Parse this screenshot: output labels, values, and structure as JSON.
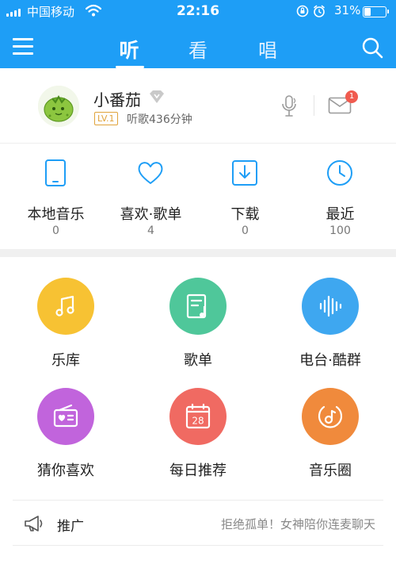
{
  "status_bar": {
    "carrier": "中国移动",
    "time": "22:16",
    "battery_percent": "31%",
    "battery_level": 0.31,
    "icons": [
      "signal-icon",
      "wifi-icon",
      "rotation-lock-icon",
      "alarm-icon",
      "battery-icon"
    ]
  },
  "nav": {
    "tabs": [
      {
        "label": "听",
        "active": true
      },
      {
        "label": "看",
        "active": false
      },
      {
        "label": "唱",
        "active": false
      }
    ],
    "icons": {
      "left": "menu-icon",
      "right": "search-icon"
    },
    "accent_color": "#1e9ef6"
  },
  "user": {
    "name": "小番茄",
    "level": "LV.1",
    "listen_time": "听歌436分钟",
    "message_badge": "1",
    "icons": [
      "avatar",
      "vip-diamond-icon",
      "microphone-icon",
      "mail-icon"
    ]
  },
  "quick_stats": [
    {
      "label": "本地音乐",
      "count": "0",
      "icon": "phone-icon"
    },
    {
      "label": "喜欢·歌单",
      "count": "4",
      "icon": "heart-icon"
    },
    {
      "label": "下载",
      "count": "0",
      "icon": "download-icon"
    },
    {
      "label": "最近",
      "count": "100",
      "icon": "clock-icon"
    }
  ],
  "grid": [
    {
      "label": "乐库",
      "icon": "music-note-icon",
      "color": "#f7c233"
    },
    {
      "label": "歌单",
      "icon": "playlist-icon",
      "color": "#4fc79a"
    },
    {
      "label": "电台·酷群",
      "icon": "sound-wave-icon",
      "color": "#3ea7f0"
    },
    {
      "label": "猜你喜欢",
      "icon": "radio-heart-icon",
      "color": "#c164dc"
    },
    {
      "label": "每日推荐",
      "icon": "calendar-icon",
      "calendar_day": "28",
      "color": "#f06a62"
    },
    {
      "label": "音乐圈",
      "icon": "music-circle-icon",
      "color": "#f08a3c"
    }
  ],
  "promo": {
    "label": "推广",
    "text": "拒绝孤单！女神陪你连麦聊天",
    "icon": "megaphone-icon"
  }
}
